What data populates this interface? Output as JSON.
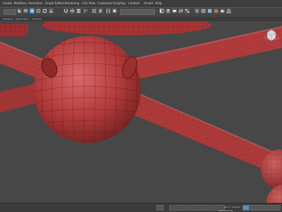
{
  "menubar": {
    "items": [
      "Create",
      "Modifiers",
      "Animation",
      "Graph Editors",
      "Rendering",
      "Civil View",
      "Customize",
      "Scripting",
      "Content",
      "Arnold",
      "Help"
    ]
  },
  "toolbar": {
    "coordinate_system": "",
    "angle_snap_label": "3°",
    "view_dropdown": ""
  },
  "ribbon": {
    "tabs": [
      "Modeling",
      "Object Paint",
      "Populate"
    ]
  },
  "viewport": {
    "label": "",
    "object_color": "#b83c3c"
  },
  "statusbar": {
    "status_text": "",
    "grid_label": "Grid = 10.0mm",
    "add_time_tag": "Add Time Tag",
    "x_value": "",
    "y_value": "",
    "z_value": ""
  }
}
